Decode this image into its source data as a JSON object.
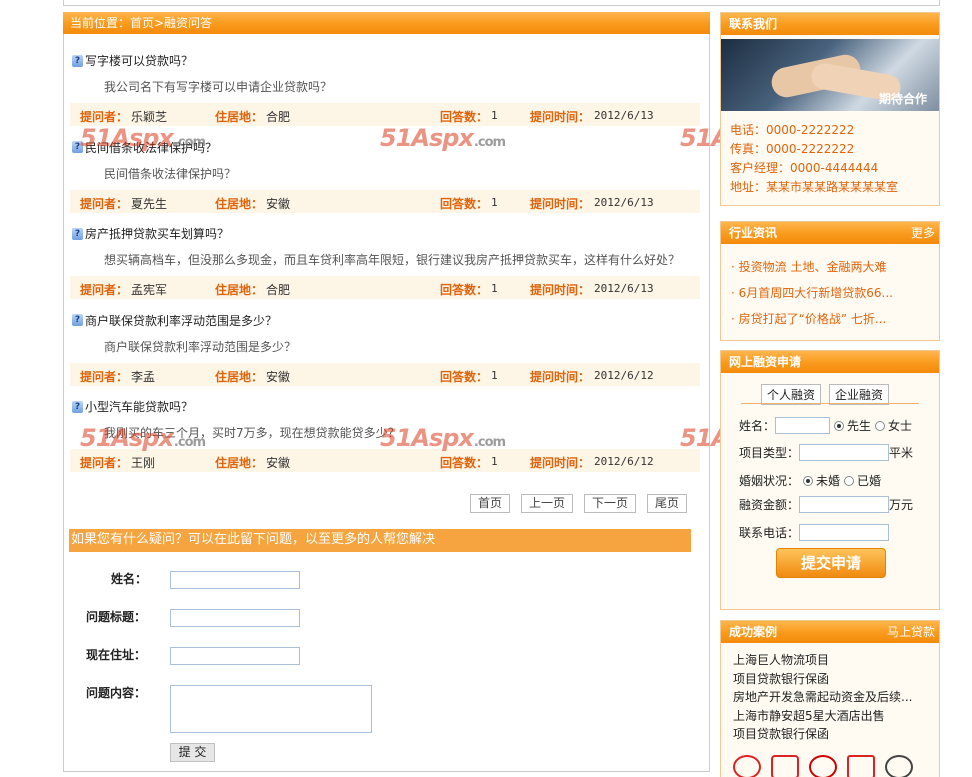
{
  "breadcrumb": "当前位置：首页>融资问答",
  "questions": [
    {
      "title": "写字楼可以贷款吗？",
      "desc": "我公司名下有写字楼可以申请企业贷款吗？",
      "asker": "乐颖芝",
      "residence": "合肥",
      "answers": "1",
      "time": "2012/6/13"
    },
    {
      "title": "民间借条收法律保护吗？",
      "desc": "民间借条收法律保护吗？",
      "asker": "夏先生",
      "residence": "安徽",
      "answers": "1",
      "time": "2012/6/13"
    },
    {
      "title": "房产抵押贷款买车划算吗？",
      "desc": "想买辆高档车，但没那么多现金，而且车贷利率高年限短，银行建议我房产抵押贷款买车，这样有什么好处？",
      "asker": "孟宪军",
      "residence": "合肥",
      "answers": "1",
      "time": "2012/6/13"
    },
    {
      "title": "商户联保贷款利率浮动范围是多少？",
      "desc": "商户联保贷款利率浮动范围是多少？",
      "asker": "李孟",
      "residence": "安徽",
      "answers": "1",
      "time": "2012/6/12"
    },
    {
      "title": "小型汽车能贷款吗？",
      "desc": "我刚买的车三个月，买时7万多，现在想贷款能贷多少？",
      "asker": "王刚",
      "residence": "安徽",
      "answers": "1",
      "time": "2012/6/12"
    }
  ],
  "meta_labels": {
    "asker": "提问者：",
    "residence": "住居地：",
    "answers": "回答数：",
    "time": "提问时间："
  },
  "pager": {
    "first": "首页",
    "prev": "上一页",
    "next": "下一页",
    "last": "尾页"
  },
  "ask": {
    "banner": "如果您有什么疑问？可以在此留下问题，以至更多的人帮您解决",
    "name_label": "姓名：",
    "title_label": "问题标题：",
    "address_label": "现在住址：",
    "content_label": "问题内容：",
    "submit": "提 交"
  },
  "watermark": {
    "main": "51Aspx",
    "suffix": ".com"
  },
  "contact": {
    "title": "联系我们",
    "image_caption": "期待合作",
    "phone": "电话：0000-2222222",
    "fax": "传真：0000-2222222",
    "manager": "客户经理：0000-4444444",
    "address": "地址：某某市某某路某某某某室"
  },
  "news": {
    "title": "行业资讯",
    "more": "更多",
    "items": [
      "· 投资物流 土地、金融两大难",
      "· 6月首周四大行新增贷款66...",
      "· 房贷打起了“价格战” 七折..."
    ]
  },
  "apply": {
    "title": "网上融资申请",
    "tab_personal": "个人融资",
    "tab_company": "企业融资",
    "name_label": "姓名：",
    "mr": "先生",
    "ms": "女士",
    "type_label": "项目类型：",
    "type_unit": "平米",
    "marital_label": "婚姻状况：",
    "unmarried": "未婚",
    "married": "已婚",
    "amount_label": "融资金额：",
    "amount_unit": "万元",
    "phone_label": "联系电话：",
    "submit": "提交申请"
  },
  "cases": {
    "title": "成功案例",
    "more": "马上贷款",
    "items": [
      "上海巨人物流项目",
      "项目贷款银行保函",
      "房地产开发急需起动资金及后续...",
      "上海市静安超5星大酒店出售",
      "项目贷款银行保函"
    ]
  },
  "colors": {
    "accent": "#f99a1c",
    "label": "#e0640c"
  }
}
